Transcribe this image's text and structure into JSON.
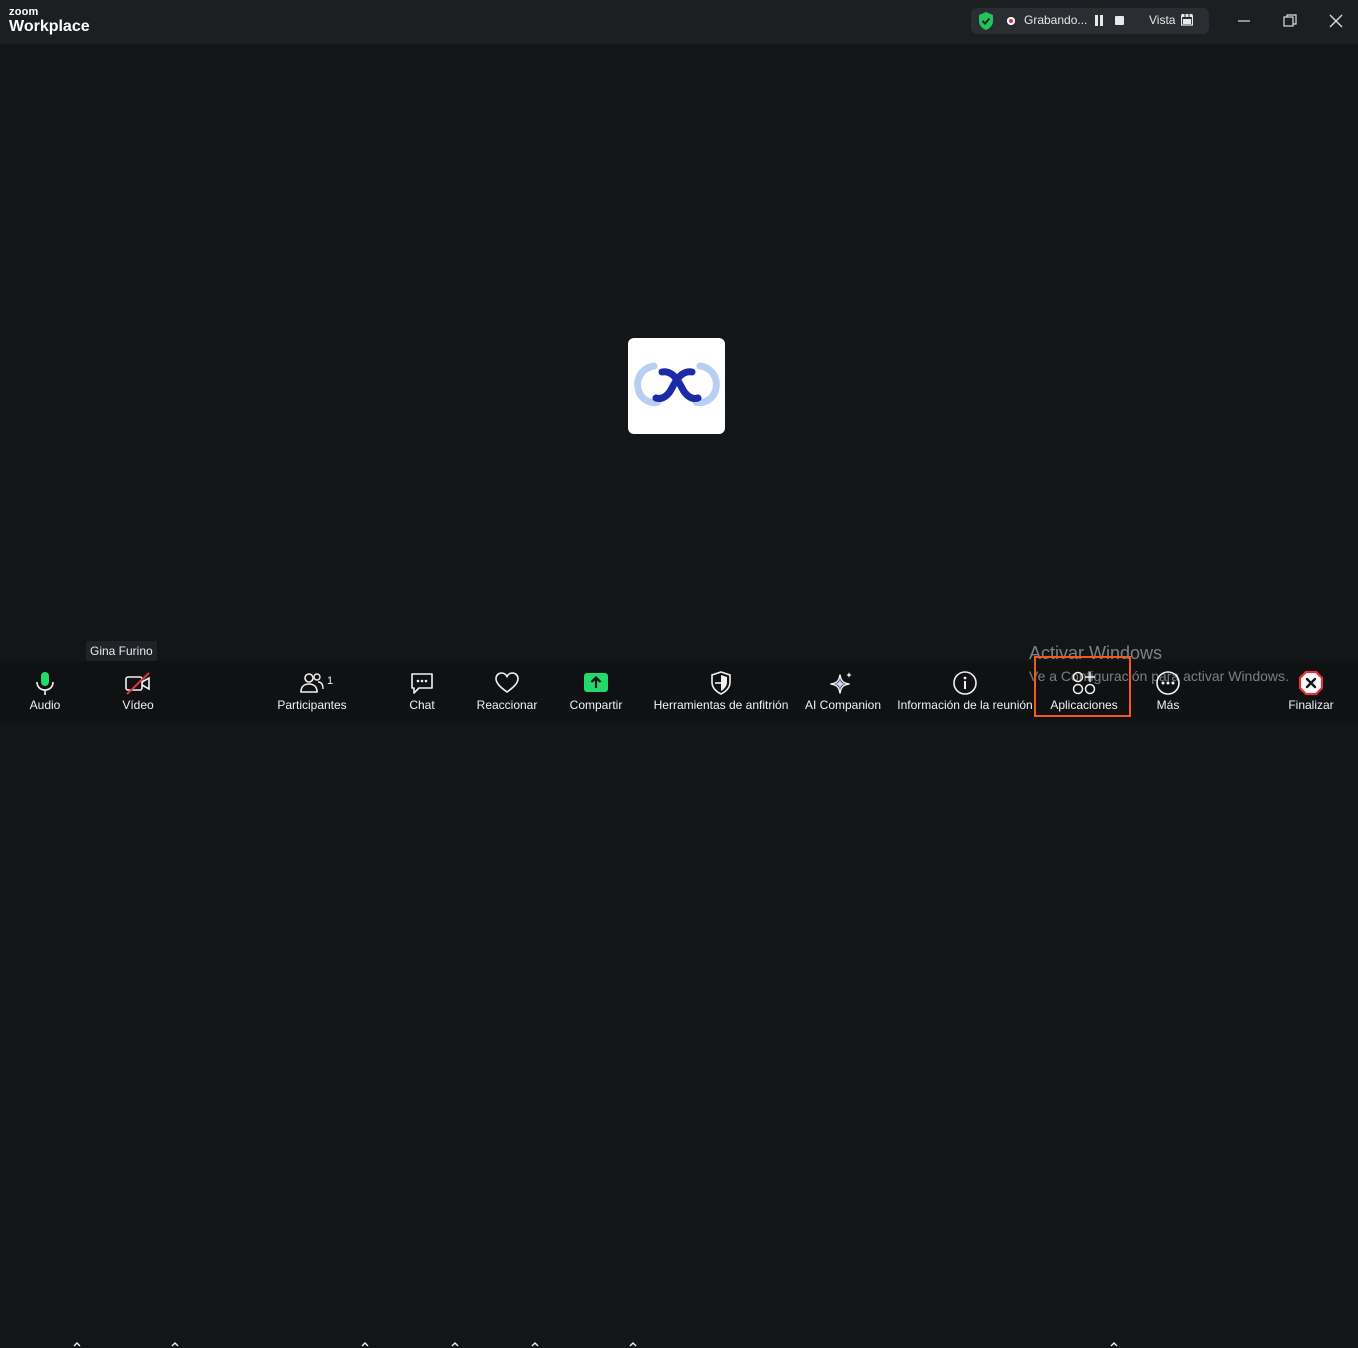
{
  "app": {
    "brand_top": "zoom",
    "brand_bottom": "Workplace"
  },
  "recording": {
    "status_text": "Grabando...",
    "view_label": "Vista"
  },
  "participant": {
    "name": "Gina Furino"
  },
  "watermark": {
    "title": "Activar Windows",
    "subtitle": "Ve a Configuración para activar Windows."
  },
  "toolbar": {
    "audio": "Audio",
    "video": "Vídeo",
    "participants": "Participantes",
    "participants_count": "1",
    "chat": "Chat",
    "react": "Reaccionar",
    "share": "Compartir",
    "host_tools": "Herramientas de anfitrión",
    "ai_companion": "AI Companion",
    "meeting_info": "Información de la reunión",
    "apps": "Aplicaciones",
    "more": "Más",
    "end": "Finalizar"
  },
  "colors": {
    "accent_green": "#23d96b",
    "end_red": "#e5323a",
    "highlight": "#f05a1e",
    "avatar_blue": "#1b2aa6",
    "avatar_light": "#b9cff2"
  }
}
